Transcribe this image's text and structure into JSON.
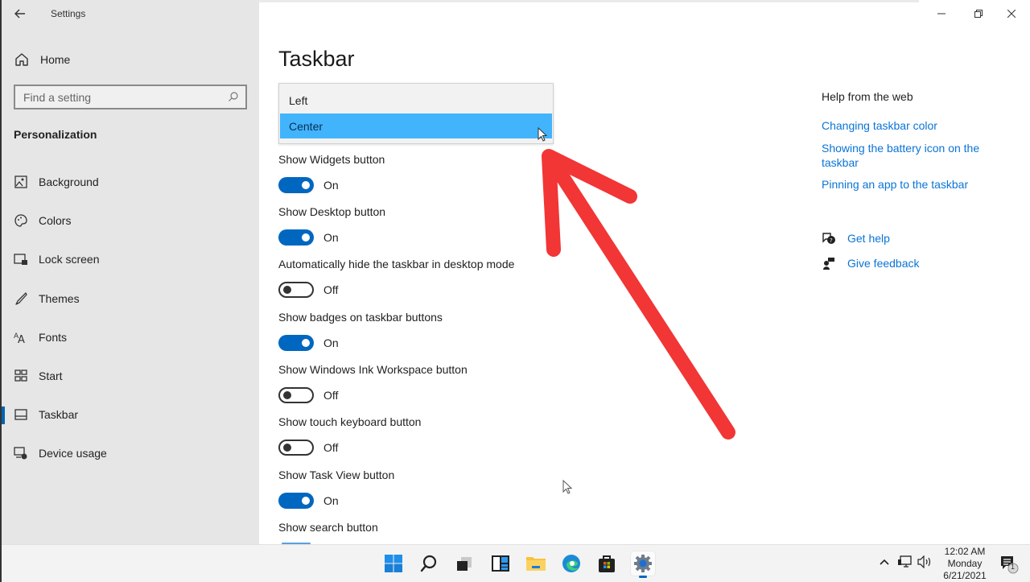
{
  "window": {
    "app_title": "Settings",
    "controls": {
      "minimize": "minimize-icon",
      "maximize": "restore-icon",
      "close": "close-icon"
    }
  },
  "sidebar": {
    "back_icon": "back-arrow-icon",
    "home": {
      "label": "Home",
      "icon": "home-icon"
    },
    "search": {
      "placeholder": "Find a setting",
      "value": "",
      "icon": "search-icon"
    },
    "section_title": "Personalization",
    "items": [
      {
        "label": "Background",
        "icon": "picture-icon",
        "active": false
      },
      {
        "label": "Colors",
        "icon": "palette-icon",
        "active": false
      },
      {
        "label": "Lock screen",
        "icon": "lock-screen-icon",
        "active": false
      },
      {
        "label": "Themes",
        "icon": "brush-icon",
        "active": false
      },
      {
        "label": "Fonts",
        "icon": "fonts-icon",
        "active": false
      },
      {
        "label": "Start",
        "icon": "start-grid-icon",
        "active": false
      },
      {
        "label": "Taskbar",
        "icon": "taskbar-icon",
        "active": true
      },
      {
        "label": "Device usage",
        "icon": "device-usage-icon",
        "active": false
      }
    ]
  },
  "main": {
    "title": "Taskbar",
    "alignment_dropdown": {
      "options": [
        "Left",
        "Center"
      ],
      "selected": "Center"
    },
    "settings": [
      {
        "label": "Show Widgets button",
        "state": "On"
      },
      {
        "label": "Show Desktop button",
        "state": "On"
      },
      {
        "label": "Automatically hide the taskbar in desktop mode",
        "state": "Off"
      },
      {
        "label": "Show badges on taskbar buttons",
        "state": "On"
      },
      {
        "label": "Show Windows Ink Workspace button",
        "state": "Off"
      },
      {
        "label": "Show touch keyboard button",
        "state": "Off"
      },
      {
        "label": "Show Task View button",
        "state": "On"
      },
      {
        "label": "Show search button",
        "state": "On"
      }
    ]
  },
  "help": {
    "title": "Help from the web",
    "links": [
      "Changing taskbar color",
      "Showing the battery icon on the taskbar",
      "Pinning an app to the taskbar"
    ],
    "get_help": {
      "label": "Get help",
      "icon": "get-help-icon"
    },
    "give_feedback": {
      "label": "Give feedback",
      "icon": "feedback-icon"
    }
  },
  "annotation": {
    "type": "red-arrow",
    "color": "#f23535",
    "points_to": "Center option"
  },
  "taskbar": {
    "apps": [
      {
        "name": "start-button",
        "icon": "windows-logo-icon"
      },
      {
        "name": "search-button",
        "icon": "search-icon"
      },
      {
        "name": "task-view-button",
        "icon": "task-view-icon"
      },
      {
        "name": "widgets-button",
        "icon": "widgets-icon"
      },
      {
        "name": "file-explorer-button",
        "icon": "folder-icon"
      },
      {
        "name": "edge-button",
        "icon": "edge-icon"
      },
      {
        "name": "store-button",
        "icon": "store-icon"
      },
      {
        "name": "settings-button",
        "icon": "gear-icon",
        "active": true
      }
    ],
    "tray": {
      "chevron": "chevron-up-icon",
      "network": "network-icon",
      "volume": "volume-icon"
    },
    "clock": {
      "time": "12:02 AM",
      "day": "Monday",
      "date": "6/21/2021"
    },
    "notifications": {
      "icon": "notification-icon",
      "count": "1"
    }
  },
  "colors": {
    "accent": "#0067c0",
    "selection": "#41b4fc",
    "link": "#0a74d6",
    "sidebar_bg": "#e6e6e6",
    "annotation": "#f23535"
  }
}
